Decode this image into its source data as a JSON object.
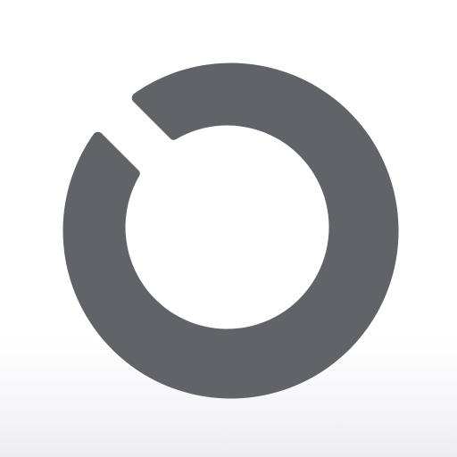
{
  "icon": {
    "name": "broken-ring-logo-icon",
    "color": "#606468"
  },
  "background": {
    "color_top": "#ffffff",
    "color_bottom": "#eeeef2"
  }
}
